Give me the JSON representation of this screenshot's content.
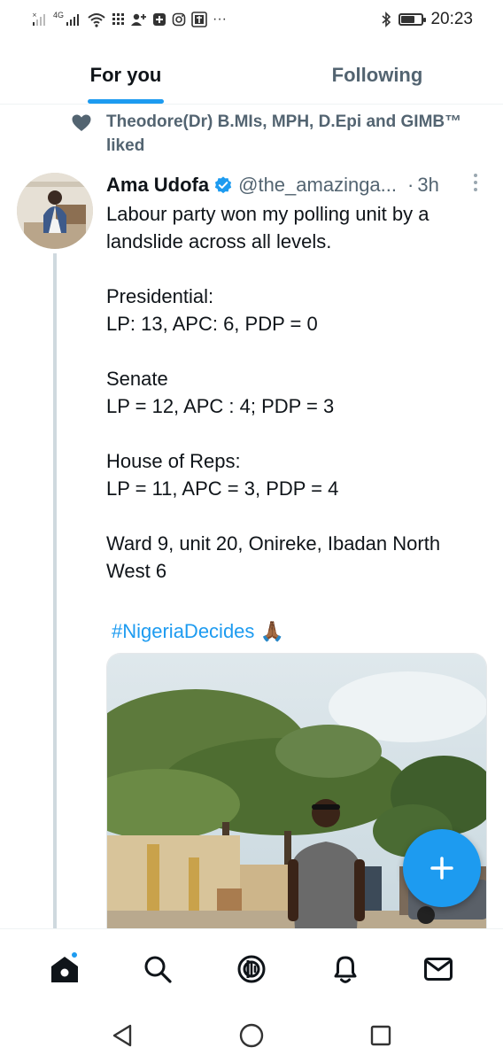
{
  "status_bar": {
    "network": "4G",
    "time": "20:23",
    "battery_level": 0.6,
    "more_indicator": "···"
  },
  "tabs": [
    {
      "label": "For you",
      "active": true
    },
    {
      "label": "Following",
      "active": false
    }
  ],
  "social_context": {
    "icon": "heart-icon",
    "text": "Theodore(Dr) B.MIs, MPH, D.Epi and GIMB™ liked"
  },
  "tweet": {
    "author_name": "Ama Udofa",
    "verified": true,
    "handle": "@the_amazinga...",
    "separator": "·",
    "time": "3h",
    "text": "Labour party won my polling unit by a landslide across all levels.\n\nPresidential:\nLP: 13, APC: 6, PDP = 0\n\nSenate\nLP = 12, APC : 4; PDP = 3\n\nHouse of Reps:\nLP = 11, APC = 3, PDP = 4\n\nWard 9, unit 20, Onireke, Ibadan North West 6",
    "hashtag": "#NigeriaDecides",
    "emoji": "🙏🏾"
  },
  "fab": {
    "icon": "plus-icon"
  },
  "bottom_nav": [
    "home-icon",
    "search-icon",
    "spaces-icon",
    "notifications-icon",
    "messages-icon"
  ],
  "system_nav": [
    "back-icon",
    "home-circle-icon",
    "recents-icon"
  ],
  "colors": {
    "accent": "#1d9bf0",
    "text_primary": "#0f1419",
    "text_secondary": "#536471",
    "divider": "#eff3f4"
  }
}
